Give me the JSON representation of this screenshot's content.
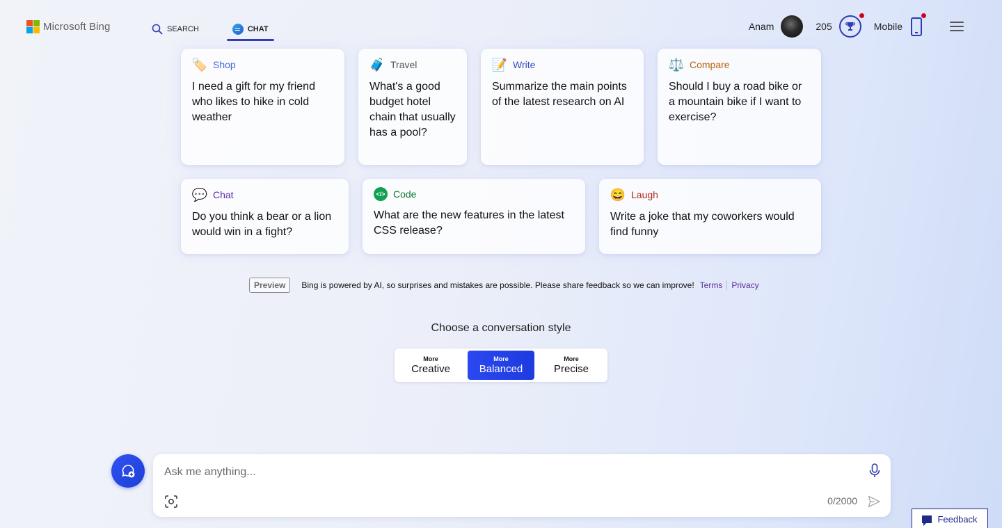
{
  "header": {
    "logo_text": "Microsoft Bing",
    "nav": [
      {
        "label": "SEARCH",
        "icon": "search-icon"
      },
      {
        "label": "CHAT",
        "icon": "chat-bubble-icon",
        "active": true
      }
    ],
    "user_name": "Anam",
    "points": "205",
    "mobile_label": "Mobile"
  },
  "cards": [
    {
      "category": "Shop",
      "icon": "🏷️",
      "color": "#3f6bd8",
      "text": "I need a gift for my friend who likes to hike in cold weather"
    },
    {
      "category": "Travel",
      "icon": "🧳",
      "color": "#555555",
      "text": "What's a good budget hotel chain that usually has a pool?"
    },
    {
      "category": "Write",
      "icon": "📝",
      "color": "#2f4fc4",
      "text": "Summarize the main points of the latest research on AI"
    },
    {
      "category": "Compare",
      "icon": "⚖️",
      "color": "#b8620a",
      "text": "Should I buy a road bike or a mountain bike if I want to exercise?"
    },
    {
      "category": "Chat",
      "icon": "💬",
      "color": "#5a2da8",
      "text": "Do you think a bear or a lion would win in a fight?"
    },
    {
      "category": "Code",
      "icon": "</>",
      "color": "#0d7a3e",
      "text": "What are the new features in the latest CSS release?"
    },
    {
      "category": "Laugh",
      "icon": "😄",
      "color": "#b3261e",
      "text": "Write a joke that my coworkers would find funny"
    }
  ],
  "disclaimer": {
    "badge": "Preview",
    "text": "Bing is powered by AI, so surprises and mistakes are possible. Please share feedback so we can improve!",
    "terms": "Terms",
    "privacy": "Privacy"
  },
  "style_chooser": {
    "title": "Choose a conversation style",
    "options": [
      {
        "more": "More",
        "name": "Creative"
      },
      {
        "more": "More",
        "name": "Balanced",
        "active": true
      },
      {
        "more": "More",
        "name": "Precise"
      }
    ]
  },
  "input": {
    "placeholder": "Ask me anything...",
    "counter": "0/2000"
  },
  "feedback_label": "Feedback",
  "colors": {
    "accent": "#2b48f0",
    "nav_underline": "#2f3bb4",
    "notification_dot": "#d0021b"
  }
}
